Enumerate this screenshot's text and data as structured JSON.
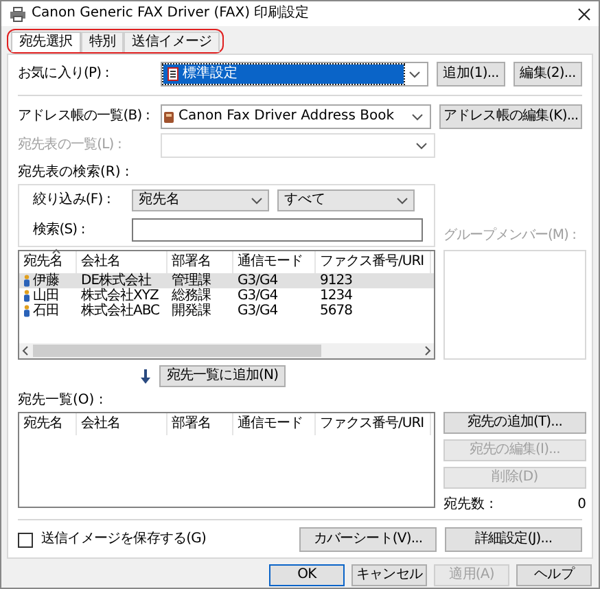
{
  "window": {
    "title": "Canon Generic FAX Driver (FAX) 印刷設定"
  },
  "tabs": [
    {
      "label": "宛先選択",
      "selected": true
    },
    {
      "label": "特別",
      "selected": false
    },
    {
      "label": "送信イメージ",
      "selected": false
    }
  ],
  "favorites": {
    "label": "お気に入り(P) :",
    "value": "標準設定",
    "buttons": [
      "追加(1)...",
      "編集(2)..."
    ]
  },
  "address_book": {
    "label": "アドレス帳の一覧(B) :",
    "value": "Canon Fax Driver Address Book",
    "button": "アドレス帳の編集(K)..."
  },
  "destination_table_list": {
    "label": "宛先表の一覧(L) :",
    "disabled": true
  },
  "search": {
    "title": "宛先表の検索(R) :",
    "filter_label": "絞り込み(F) :",
    "filter_field": "宛先名",
    "filter_value": "すべて",
    "search_label": "検索(S) :"
  },
  "address_table": {
    "columns": [
      {
        "label": "宛先名",
        "sorted": true
      },
      {
        "label": "会社名",
        "sorted": false
      },
      {
        "label": "部署名",
        "sorted": false
      },
      {
        "label": "通信モード",
        "sorted": false
      },
      {
        "label": "ファクス番号/URI",
        "sorted": false
      }
    ],
    "rows": [
      {
        "cells": [
          "伊藤",
          "DE株式会社",
          "管理課",
          "G3/G4",
          "9123"
        ],
        "selected": true
      },
      {
        "cells": [
          "山田",
          "株式会社XYZ",
          "総務課",
          "G3/G4",
          "1234"
        ],
        "selected": false
      },
      {
        "cells": [
          "石田",
          "株式会社ABC",
          "開発課",
          "G3/G4",
          "5678"
        ],
        "selected": false
      }
    ]
  },
  "group_members": {
    "label": "グループメンバー(M) :",
    "disabled": true
  },
  "add_to_list_button": "宛先一覧に追加(N)",
  "destination_list": {
    "label": "宛先一覧(O) :",
    "columns": [
      {
        "label": "宛先名",
        "sorted": false
      },
      {
        "label": "会社名",
        "sorted": false
      },
      {
        "label": "部署名",
        "sorted": false
      },
      {
        "label": "通信モード",
        "sorted": false
      },
      {
        "label": "ファクス番号/URI",
        "sorted": false
      }
    ]
  },
  "side_buttons": [
    {
      "label": "宛先の追加(T)...",
      "disabled": false
    },
    {
      "label": "宛先の編集(I)...",
      "disabled": true
    },
    {
      "label": "削除(D)",
      "disabled": true
    }
  ],
  "count": {
    "label": "宛先数 :",
    "value": "0"
  },
  "save_image": {
    "label": "送信イメージを保存する(G)",
    "checked": false
  },
  "option_buttons": [
    "カバーシート(V)...",
    "詳細設定(J)..."
  ],
  "dialog_buttons": [
    {
      "label": "OK",
      "disabled": false,
      "default": true
    },
    {
      "label": "キャンセル",
      "disabled": false,
      "default": false
    },
    {
      "label": "適用(A)",
      "disabled": true,
      "default": false
    },
    {
      "label": "ヘルプ",
      "disabled": false,
      "default": false
    }
  ]
}
